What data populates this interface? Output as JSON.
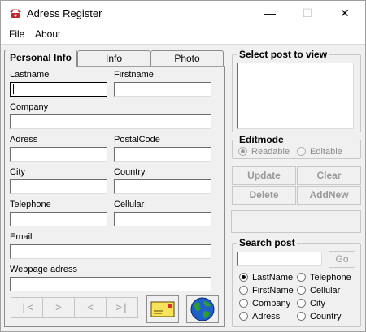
{
  "window": {
    "title": "Adress Register",
    "icon": "telephone-icon",
    "minimize": "—",
    "maximize": "☐",
    "close": "✕"
  },
  "menu": {
    "file": "File",
    "about": "About"
  },
  "tabs": [
    "Personal Info",
    "Info",
    "Photo"
  ],
  "form": {
    "lastname_label": "Lastname",
    "firstname_label": "Firstname",
    "company_label": "Company",
    "adress_label": "Adress",
    "postalcode_label": "PostalCode",
    "city_label": "City",
    "country_label": "Country",
    "telephone_label": "Telephone",
    "cellular_label": "Cellular",
    "email_label": "Email",
    "webpage_label": "Webpage adress"
  },
  "nav": {
    "first": "|<",
    "next": ">",
    "prev": "<",
    "last": ">|"
  },
  "icons": {
    "mail": "envelope-icon",
    "web": "globe-icon"
  },
  "select_post": {
    "title": "Select post to view"
  },
  "editmode": {
    "title": "Editmode",
    "readable": "Readable",
    "editable": "Editable",
    "selected": "Readable"
  },
  "actions": {
    "update": "Update",
    "clear": "Clear",
    "delete": "Delete",
    "addnew": "AddNew"
  },
  "search": {
    "title": "Search post",
    "go": "Go",
    "selected": "LastName",
    "options": [
      "LastName",
      "Telephone",
      "FirstName",
      "Cellular",
      "Company",
      "City",
      "Adress",
      "Country"
    ]
  },
  "colors": {
    "window_bg": "#f0f0f0",
    "disabled_text": "#9a9a9a"
  }
}
